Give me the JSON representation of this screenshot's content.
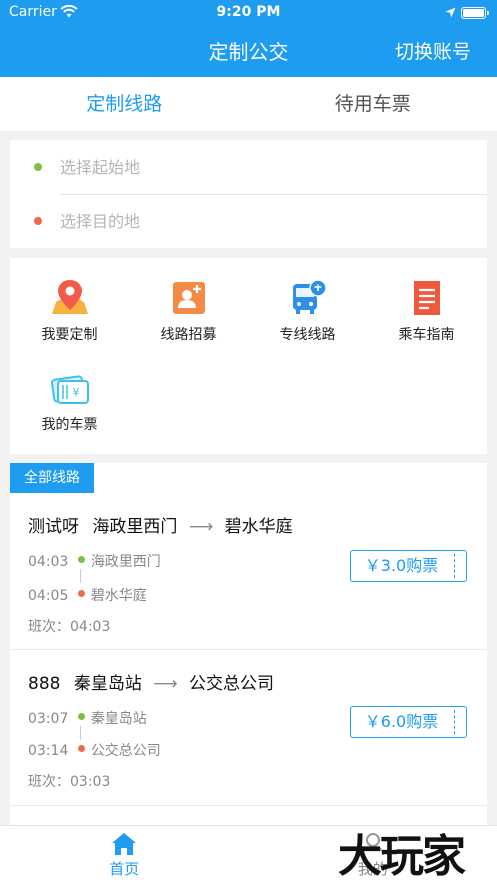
{
  "status": {
    "carrier": "Carrier",
    "time": "9:20 PM"
  },
  "header": {
    "title": "定制公交",
    "switch_account": "切换账号"
  },
  "tabs": [
    {
      "label": "定制线路",
      "active": true
    },
    {
      "label": "待用车票",
      "active": false
    }
  ],
  "location": {
    "start_placeholder": "选择起始地",
    "end_placeholder": "选择目的地",
    "start_dot_color": "#7ac143",
    "end_dot_color": "#f06a4f"
  },
  "features": [
    {
      "label": "我要定制",
      "icon": "map-pin-icon"
    },
    {
      "label": "线路招募",
      "icon": "recruit-contact-icon"
    },
    {
      "label": "专线线路",
      "icon": "bus-icon"
    },
    {
      "label": "乘车指南",
      "icon": "guide-document-icon"
    },
    {
      "label": "我的车票",
      "icon": "ticket-icon"
    }
  ],
  "routes_section": {
    "badge": "全部线路",
    "routes": [
      {
        "name": "测试呀",
        "from": "海政里西门",
        "to": "碧水华庭",
        "depart_time": "04:03",
        "depart_stop": "海政里西门",
        "arrive_time": "04:05",
        "arrive_stop": "碧水华庭",
        "shift": "班次：04:03",
        "price": "￥3.0购票"
      },
      {
        "name": "888",
        "from": "秦皇岛站",
        "to": "公交总公司",
        "depart_time": "03:07",
        "depart_stop": "秦皇岛站",
        "arrive_time": "03:14",
        "arrive_stop": "公交总公司",
        "shift": "班次：03:03",
        "price": "￥6.0购票"
      }
    ]
  },
  "tabbar": [
    {
      "label": "首页",
      "icon": "home-icon",
      "active": true
    },
    {
      "label": "我的",
      "icon": "profile-icon",
      "active": false
    }
  ],
  "watermark": "大玩家",
  "colors": {
    "primary": "#1e9cf0",
    "green_dot": "#7ac143",
    "red_dot": "#f06a4f"
  }
}
